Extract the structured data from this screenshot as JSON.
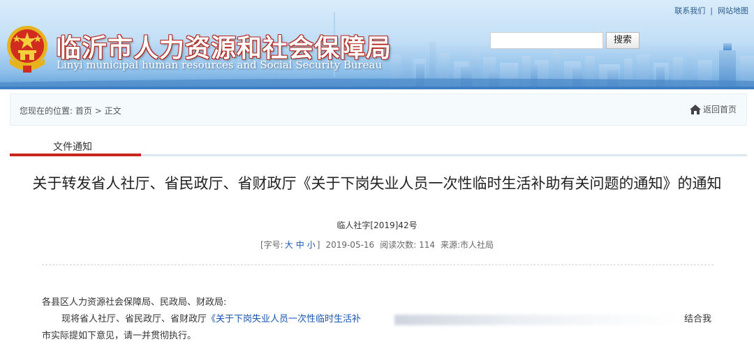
{
  "header": {
    "top_links": {
      "contact": "联系我们",
      "separator": "|",
      "sitemap": "网站地图"
    },
    "title": "临沂市人力资源和社会保障局",
    "subtitle": "Linyi municipal human resources and Social Security Bureau",
    "search": {
      "placeholder": "",
      "button_label": "搜索"
    }
  },
  "location": {
    "prefix": "您现在的位置: ",
    "home": "首页",
    "arrow": " > ",
    "current": "正文",
    "home_link_label": "返回首页"
  },
  "tab": {
    "label": "文件通知"
  },
  "article": {
    "title": "关于转发省人社厅、省民政厅、省财政厅《关于下岗失业人员一次性临时生活补助有关问题的通知》的通知",
    "doc_number": "临人社字[2019]42号",
    "meta": {
      "font_size_prefix": "[字号:",
      "font_large": "大",
      "font_medium": "中",
      "font_small": "小",
      "font_size_suffix": "]",
      "date": "2019-05-16",
      "read_count_label": "阅读次数:",
      "read_count": "114",
      "source_label": "来源:",
      "source": "市人社局"
    },
    "paragraphs": {
      "salutation": "各县区人力资源社会保障局、民政局、财政局:",
      "p2_start": "现将省人社厅、省民政厅、省财政厅",
      "p2_blue": "《关于下岗失业人员一次性临时生活补",
      "p2_end": "结合我",
      "p3": "市实际提如下意见，请一并贯彻执行。"
    }
  },
  "colors": {
    "accent_red": "#c9261b",
    "link_blue": "#1a56b0",
    "header_blue": "#3d7ec4"
  }
}
